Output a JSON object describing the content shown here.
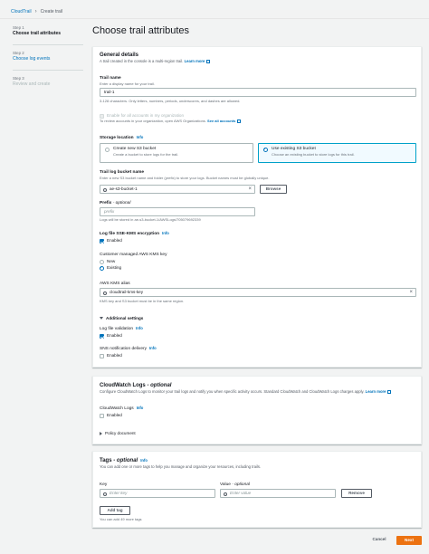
{
  "breadcrumb": {
    "root": "CloudTrail",
    "current": "Create trail"
  },
  "steps": [
    {
      "num": "Step 1",
      "title": "Choose trail attributes"
    },
    {
      "num": "Step 2",
      "title": "Choose log events"
    },
    {
      "num": "Step 3",
      "title": "Review and create"
    }
  ],
  "page_title": "Choose trail attributes",
  "general": {
    "title": "General details",
    "desc": "A trail created in the console is a multi-region trail.",
    "learn_more": "Learn more",
    "trail_name_label": "Trail name",
    "trail_name_desc": "Enter a display name for your trail.",
    "trail_name_value": "trail-1",
    "trail_name_hint": "3-128 characters. Only letters, numbers, periods, underscores, and dashes are allowed.",
    "org_label": "Enable for all accounts in my organization",
    "org_desc": "To review accounts in your organization, open AWS Organizations.",
    "see_all": "See all accounts",
    "storage_label": "Storage location",
    "info": "Info",
    "new_bucket_title": "Create new S3 bucket",
    "new_bucket_desc": "Create a bucket to store logs for the trail.",
    "existing_bucket_title": "Use existing S3 bucket",
    "existing_bucket_desc": "Choose an existing bucket to store logs for this trail.",
    "bucket_label": "Trail log bucket name",
    "bucket_desc": "Enter a new S3 bucket name and folder (prefix) to store your logs. Bucket names must be globally unique.",
    "bucket_value": "ae-s3-bucket-1",
    "browse": "Browse",
    "prefix_label": "Prefix",
    "optional": "- optional",
    "prefix_placeholder": "prefix",
    "prefix_hint": "Logs will be stored in ae-s3-bucket-1/AWSLogs/705079692339",
    "sse_label": "Log file SSE-KMS encryption",
    "enabled": "Enabled",
    "kms_label": "Customer managed AWS KMS key",
    "kms_new": "New",
    "kms_existing": "Existing",
    "alias_label": "AWS KMS alias",
    "alias_value": "cloudtrail-kms-key",
    "alias_hint": "KMS key and S3 bucket must be in the same region.",
    "additional": "Additional settings",
    "validation_label": "Log file validation",
    "sns_label": "SNS notification delivery"
  },
  "cloudwatch": {
    "title": "CloudWatch Logs",
    "optional": "- optional",
    "desc": "Configure CloudWatch Logs to monitor your trail logs and notify you when specific activity occurs. Standard CloudWatch and CloudWatch Logs charges apply.",
    "learn_more": "Learn more",
    "label": "CloudWatch Logs",
    "info": "Info",
    "enabled": "Enabled",
    "policy": "Policy document"
  },
  "tags": {
    "title": "Tags",
    "optional": "- optional",
    "info": "Info",
    "desc": "You can add one or more tags to help you manage and organize your resources, including trails.",
    "key_label": "Key",
    "key_placeholder": "Enter key",
    "value_label": "Value",
    "value_optional": "- optional",
    "value_placeholder": "Enter value",
    "remove": "Remove",
    "add": "Add tag",
    "hint": "You can add 49 more tags"
  },
  "footer": {
    "cancel": "Cancel",
    "next": "Next"
  }
}
